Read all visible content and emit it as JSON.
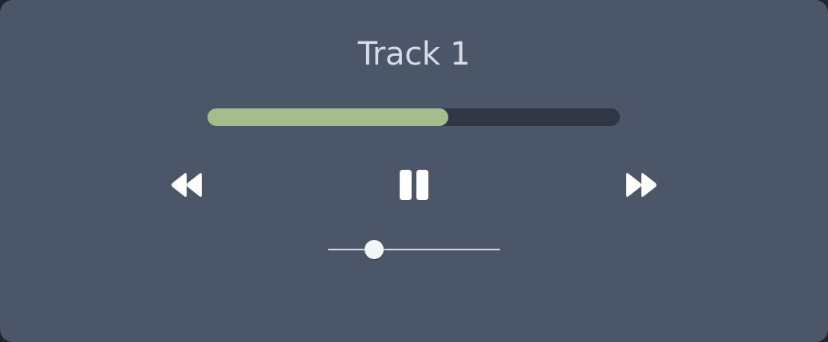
{
  "player": {
    "track_title": "Track 1",
    "progress_fraction": 0.585,
    "volume_fraction": 0.27,
    "colors": {
      "background": "#4c5669",
      "progress_fill": "#a3be8c",
      "progress_track": "#303643",
      "icon": "#ffffff"
    },
    "controls": {
      "rewind_icon": "rewind-icon",
      "pause_icon": "pause-icon",
      "forward_icon": "fast-forward-icon"
    }
  }
}
